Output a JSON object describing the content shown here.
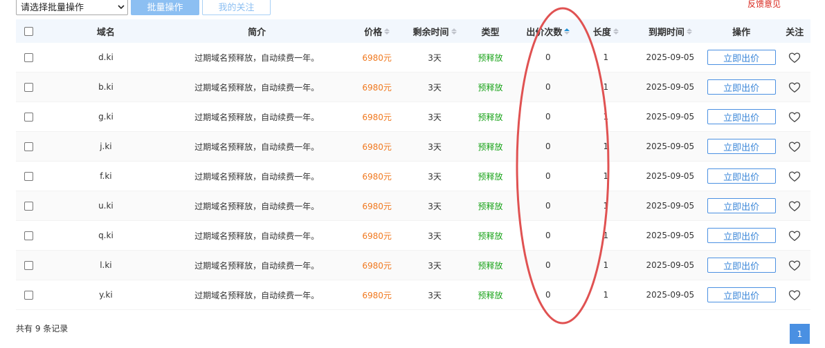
{
  "toolbar": {
    "select_value": "请选择批量操作",
    "batch_button": "批量操作",
    "watch_button": "我的关注"
  },
  "feedback": "反馈意见",
  "table": {
    "headers": {
      "domain": "域名",
      "desc": "简介",
      "price": "价格",
      "time": "剩余时间",
      "type": "类型",
      "bids": "出价次数",
      "length": "长度",
      "expire": "到期时间",
      "op": "操作",
      "fav": "关注"
    },
    "rows": [
      {
        "domain": "d.ki",
        "desc": "过期域名预释放，自动续费一年。",
        "price": "6980元",
        "time": "3天",
        "type": "预释放",
        "bids": "0",
        "length": "1",
        "expire": "2025-09-05",
        "action": "立即出价"
      },
      {
        "domain": "b.ki",
        "desc": "过期域名预释放，自动续费一年。",
        "price": "6980元",
        "time": "3天",
        "type": "预释放",
        "bids": "0",
        "length": "1",
        "expire": "2025-09-05",
        "action": "立即出价"
      },
      {
        "domain": "g.ki",
        "desc": "过期域名预释放，自动续费一年。",
        "price": "6980元",
        "time": "3天",
        "type": "预释放",
        "bids": "0",
        "length": "1",
        "expire": "2025-09-05",
        "action": "立即出价"
      },
      {
        "domain": "j.ki",
        "desc": "过期域名预释放，自动续费一年。",
        "price": "6980元",
        "time": "3天",
        "type": "预释放",
        "bids": "0",
        "length": "1",
        "expire": "2025-09-05",
        "action": "立即出价"
      },
      {
        "domain": "f.ki",
        "desc": "过期域名预释放，自动续费一年。",
        "price": "6980元",
        "time": "3天",
        "type": "预释放",
        "bids": "0",
        "length": "1",
        "expire": "2025-09-05",
        "action": "立即出价"
      },
      {
        "domain": "u.ki",
        "desc": "过期域名预释放，自动续费一年。",
        "price": "6980元",
        "time": "3天",
        "type": "预释放",
        "bids": "0",
        "length": "1",
        "expire": "2025-09-05",
        "action": "立即出价"
      },
      {
        "domain": "q.ki",
        "desc": "过期域名预释放，自动续费一年。",
        "price": "6980元",
        "time": "3天",
        "type": "预释放",
        "bids": "0",
        "length": "1",
        "expire": "2025-09-05",
        "action": "立即出价"
      },
      {
        "domain": "l.ki",
        "desc": "过期域名预释放，自动续费一年。",
        "price": "6980元",
        "time": "3天",
        "type": "预释放",
        "bids": "0",
        "length": "1",
        "expire": "2025-09-05",
        "action": "立即出价"
      },
      {
        "domain": "y.ki",
        "desc": "过期域名预释放，自动续费一年。",
        "price": "6980元",
        "time": "3天",
        "type": "预释放",
        "bids": "0",
        "length": "1",
        "expire": "2025-09-05",
        "action": "立即出价"
      }
    ]
  },
  "footer": {
    "record_count": "共有 9 条记录",
    "page": "1"
  },
  "colors": {
    "accent": "#4a90e2",
    "price": "#f0781e",
    "type": "#19a319",
    "annotation": "#e05252"
  },
  "icons": {
    "favorite": "heart-outline-icon",
    "sort": "sort-caret-icon",
    "select": "chevron-down-icon"
  }
}
